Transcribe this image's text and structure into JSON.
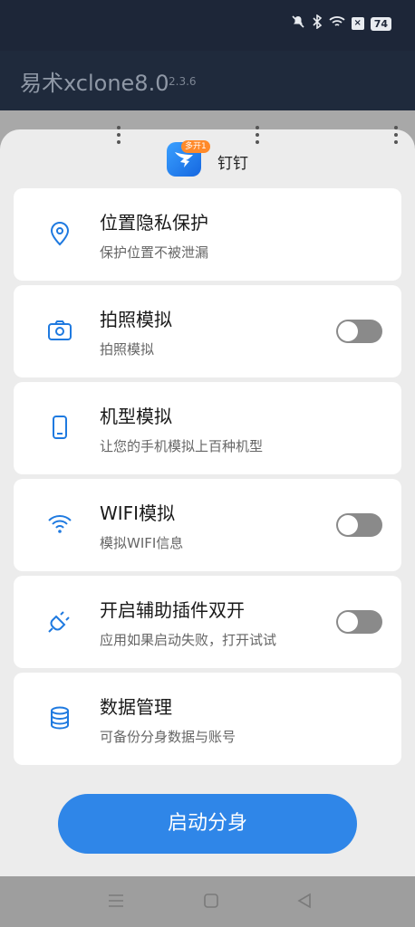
{
  "status_bar": {
    "battery": "74"
  },
  "app_header": {
    "title": "易术xclone8.0",
    "version": "2.3.6"
  },
  "sheet": {
    "app_name": "钉钉",
    "app_badge": "多开1",
    "cards": [
      {
        "title": "位置隐私保护",
        "subtitle": "保护位置不被泄漏",
        "icon": "location-pin-icon",
        "has_toggle": false
      },
      {
        "title": "拍照模拟",
        "subtitle": "拍照模拟",
        "icon": "camera-icon",
        "has_toggle": true,
        "toggle_on": false
      },
      {
        "title": "机型模拟",
        "subtitle": "让您的手机模拟上百种机型",
        "icon": "phone-icon",
        "has_toggle": false
      },
      {
        "title": "WIFI模拟",
        "subtitle": "模拟WIFI信息",
        "icon": "wifi-icon",
        "has_toggle": true,
        "toggle_on": false
      },
      {
        "title": "开启辅助插件双开",
        "subtitle": "应用如果启动失败，打开试试",
        "icon": "plugin-icon",
        "has_toggle": true,
        "toggle_on": false
      },
      {
        "title": "数据管理",
        "subtitle": "可备份分身数据与账号",
        "icon": "database-icon",
        "has_toggle": false
      }
    ],
    "start_button": "启动分身"
  },
  "colors": {
    "accent": "#2f86e8",
    "icon_blue": "#1f7ae0",
    "toggle_off": "#8a8a8a"
  }
}
